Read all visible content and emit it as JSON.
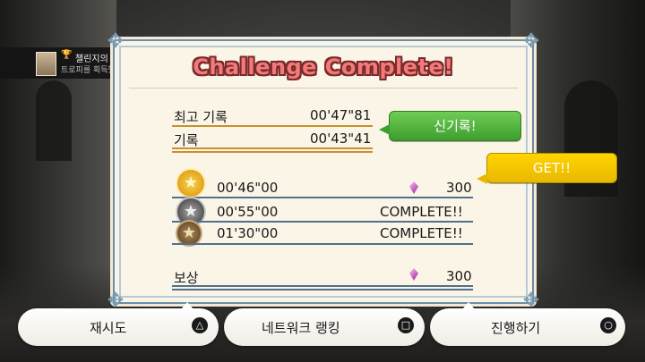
{
  "notification": {
    "trophy_name": "챌린지의 여왕",
    "message": "트로피를 획득했습니다!",
    "trophy_icon": "trophy-icon",
    "platform_icon": "playstation-icon"
  },
  "panel": {
    "title": "Challenge Complete!",
    "records": {
      "best_label": "최고 기록",
      "best_time": "00'47\"81",
      "record_label": "기록",
      "record_time": "00'43\"41",
      "new_record_bubble": "신기록!"
    },
    "medals": [
      {
        "tier": "gold",
        "time": "00'46\"00",
        "result": "300",
        "icon": "gold-medal-icon"
      },
      {
        "tier": "silver",
        "time": "00'55\"00",
        "result": "COMPLETE!!",
        "icon": "silver-medal-icon"
      },
      {
        "tier": "bronze",
        "time": "01'30\"00",
        "result": "COMPLETE!!",
        "icon": "bronze-medal-icon"
      }
    ],
    "get_bubble": "GET!!",
    "reward": {
      "label": "보상",
      "amount": "300",
      "icon": "gem-icon"
    }
  },
  "buttons": [
    {
      "label": "재시도",
      "glyph": "△",
      "glyph_name": "triangle-button-icon"
    },
    {
      "label": "네트워크 랭킹",
      "glyph": "□",
      "glyph_name": "square-button-icon"
    },
    {
      "label": "진행하기",
      "glyph": "○",
      "glyph_name": "circle-button-icon"
    }
  ],
  "colors": {
    "title": "#f37a7a",
    "accent_orange": "#c8902e",
    "accent_blue": "#52708a",
    "bubble_green": "#4fb13c",
    "bubble_yellow": "#ffd400"
  }
}
